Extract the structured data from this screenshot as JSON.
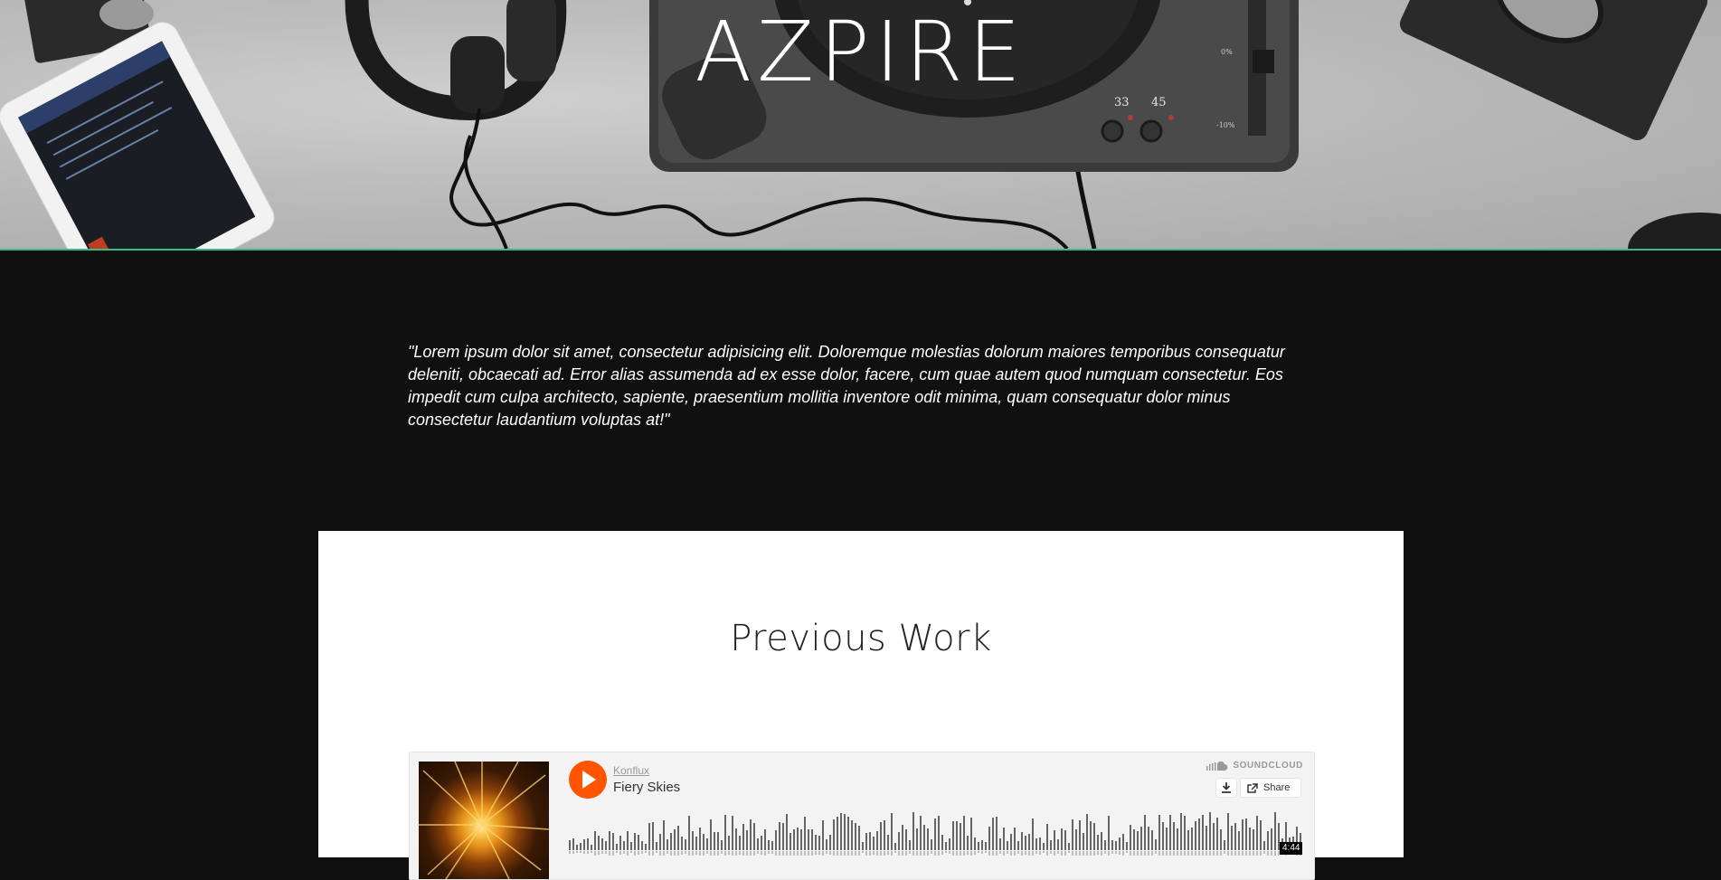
{
  "hero": {
    "logo_text": "AZPIRE",
    "turntable_speeds": [
      "33",
      "45"
    ],
    "pitch_marks": [
      "0%",
      "-10%"
    ]
  },
  "quote": {
    "text": "\"Lorem ipsum dolor sit amet, consectetur adipisicing elit. Doloremque molestias dolorum maiores temporibus consequatur deleniti, obcaecati ad. Error alias assumenda ad ex esse dolor, facere, cum quae autem quod numquam consectetur. Eos impedit cum culpa architecto, sapiente, praesentium mollitia inventore odit minima, quam consequatur dolor minus consectetur laudantium voluptas at!\""
  },
  "work": {
    "title": "Previous Work",
    "player": {
      "artist": "Konflux",
      "track": "Fiery Skies",
      "brand": "SOUNDCLOUD",
      "share_label": "Share",
      "duration": "4:44",
      "accent_color": "#ff5500",
      "icons": [
        "play-icon",
        "soundcloud-logo-icon",
        "download-icon",
        "share-icon"
      ]
    }
  }
}
